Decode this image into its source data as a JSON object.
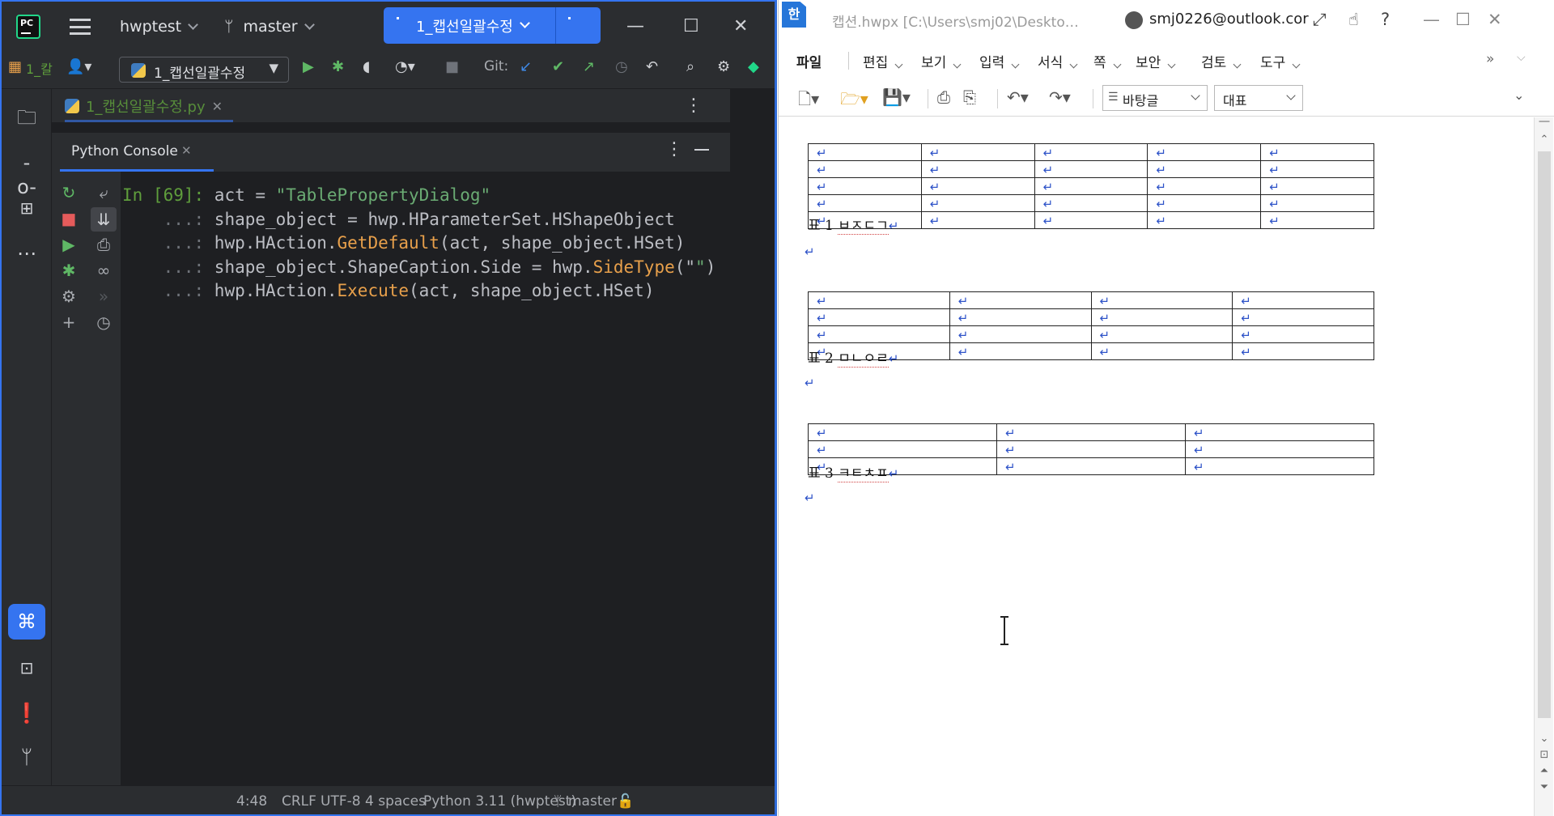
{
  "ide": {
    "project": "hwptest",
    "branch": "master",
    "run_config": "1_캡선일괄수정",
    "toolbar_project_short": "1_칼",
    "git_label": "Git:",
    "file_tab": "1_캡선일괄수정.py",
    "console_tab": "Python Console",
    "console_lines": [
      {
        "prompt": "In [69]: ",
        "parts": [
          {
            "t": "act = ",
            "c": "code"
          },
          {
            "t": "\"TablePropertyDialog\"",
            "c": "str"
          }
        ]
      },
      {
        "prompt": "    ...: ",
        "parts": [
          {
            "t": "shape_object = hwp.HParameterSet.HShapeObject",
            "c": "code"
          }
        ]
      },
      {
        "prompt": "    ...: ",
        "parts": [
          {
            "t": "hwp.HAction.",
            "c": "code"
          },
          {
            "t": "GetDefault",
            "c": "fn"
          },
          {
            "t": "(act, shape_object.HSet)",
            "c": "code"
          }
        ]
      },
      {
        "prompt": "    ...: ",
        "parts": [
          {
            "t": "shape_object.ShapeCaption.Side = hwp.",
            "c": "code"
          },
          {
            "t": "SideType",
            "c": "fn"
          },
          {
            "t": "(\"",
            "c": "code"
          },
          {
            "t": "\"",
            "c": "str"
          },
          {
            "t": ")",
            "c": "code"
          }
        ]
      },
      {
        "prompt": "    ...: ",
        "parts": [
          {
            "t": "hwp.HAction.",
            "c": "code"
          },
          {
            "t": "Execute",
            "c": "fn"
          },
          {
            "t": "(act, shape_object.HSet)",
            "c": "code"
          }
        ]
      }
    ],
    "status": {
      "position": "4:48",
      "line_sep": "CRLF",
      "encoding": "UTF-8",
      "indent": "4 spaces",
      "interpreter": "Python 3.11 (hwptest)",
      "branch": "master"
    },
    "colors": {
      "accent": "#3574f0",
      "bg": "#1e1f22",
      "panel": "#2b2d30"
    }
  },
  "hwp": {
    "logo": "한",
    "doc_title": "캡션.hwpx [C:\\Users\\smj02\\Deskto…",
    "account": "smj0226@outlook.cor",
    "menus": [
      "파일",
      "편집",
      "보기",
      "입력",
      "서식",
      "쪽",
      "보안",
      "검토",
      "도구"
    ],
    "style_select": "바탕글",
    "font_select": "대표",
    "return_mark": "↵",
    "tables": [
      {
        "rows": 5,
        "cols": 5,
        "caption_label": "표 1 ",
        "caption_text": "ㅂㅈㄷㄱ"
      },
      {
        "rows": 4,
        "cols": 4,
        "caption_label": "표 2 ",
        "caption_text": "ㅁㄴㅇㄹ"
      },
      {
        "rows": 3,
        "cols": 3,
        "caption_label": "표 3 ",
        "caption_text": "ㅋㅌㅊㅍ"
      }
    ]
  }
}
